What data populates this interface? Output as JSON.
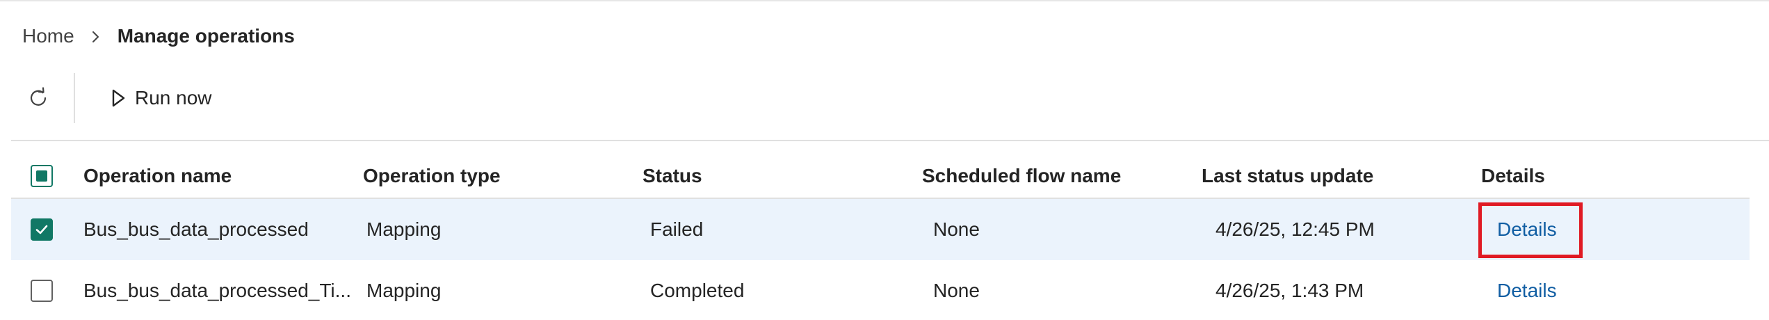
{
  "breadcrumb": {
    "home": "Home",
    "current": "Manage operations"
  },
  "toolbar": {
    "refresh_icon": "refresh-icon",
    "run_now_label": "Run now",
    "run_icon": "play-icon"
  },
  "table": {
    "columns": [
      "Operation name",
      "Operation type",
      "Status",
      "Scheduled flow name",
      "Last status update",
      "Details"
    ],
    "rows": [
      {
        "selected": true,
        "name": "Bus_bus_data_processed",
        "type": "Mapping",
        "status": "Failed",
        "flow": "None",
        "updated": "4/26/25, 12:45 PM",
        "details": "Details"
      },
      {
        "selected": false,
        "name": "Bus_bus_data_processed_Ti...",
        "type": "Mapping",
        "status": "Completed",
        "flow": "None",
        "updated": "4/26/25, 1:43 PM",
        "details": "Details"
      }
    ]
  },
  "colors": {
    "accent": "#117865",
    "selected_row": "#ebf3fc",
    "link": "#115ea3",
    "highlight": "#e01a24"
  }
}
